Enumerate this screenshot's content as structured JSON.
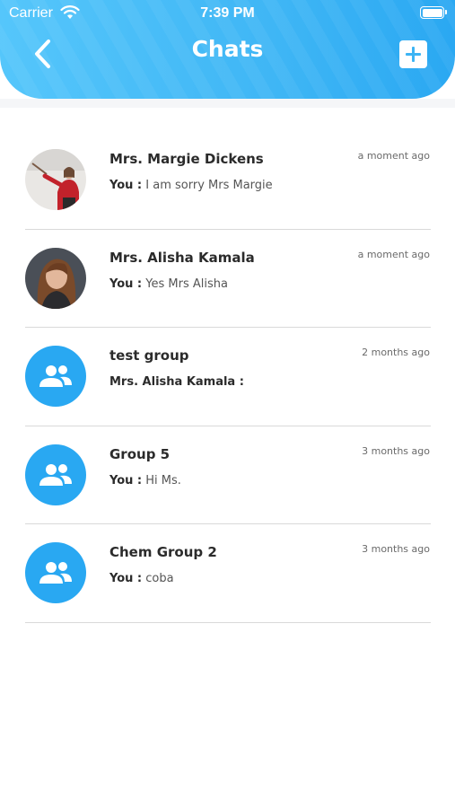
{
  "status_bar": {
    "carrier": "Carrier",
    "time": "7:39 PM"
  },
  "header": {
    "title": "Chats",
    "back_icon": "chevron-left-icon",
    "add_icon": "plus-square-icon"
  },
  "colors": {
    "accent": "#3cb4f4",
    "group_avatar": "#29a8f2",
    "divider": "#d9d9d9"
  },
  "chats": [
    {
      "name": "Mrs. Margie Dickens",
      "time": "a moment ago",
      "sender": "You :",
      "message": " I am sorry Mrs Margie",
      "avatar": "photo"
    },
    {
      "name": "Mrs. Alisha Kamala",
      "time": "a moment ago",
      "sender": "You :",
      "message": " Yes Mrs Alisha",
      "avatar": "photo"
    },
    {
      "name": "test group",
      "time": "2 months ago",
      "sender": "Mrs. Alisha Kamala :",
      "message": "",
      "avatar": "group-icon"
    },
    {
      "name": "Group 5",
      "time": "3 months ago",
      "sender": "You :",
      "message": " Hi Ms.",
      "avatar": "group-icon"
    },
    {
      "name": "Chem Group 2",
      "time": "3 months ago",
      "sender": "You :",
      "message": " coba",
      "avatar": "group-icon"
    }
  ]
}
